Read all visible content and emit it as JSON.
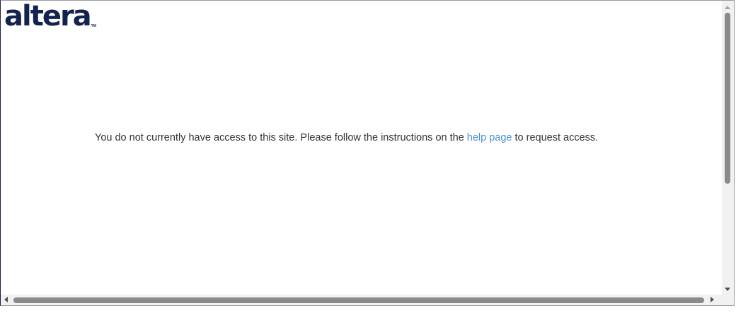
{
  "logo": {
    "text": "altera",
    "trademark": "TM",
    "color": "#13224f"
  },
  "message": {
    "before_link": "You do not currently have access to this site. Please follow the instructions on the ",
    "link_text": "help page",
    "after_link": " to request access.",
    "link_color": "#4a90d9"
  },
  "icons": {
    "scroll_up": "chevron-up-icon",
    "scroll_down": "chevron-down-icon",
    "scroll_left": "chevron-left-icon",
    "scroll_right": "chevron-right-icon"
  }
}
